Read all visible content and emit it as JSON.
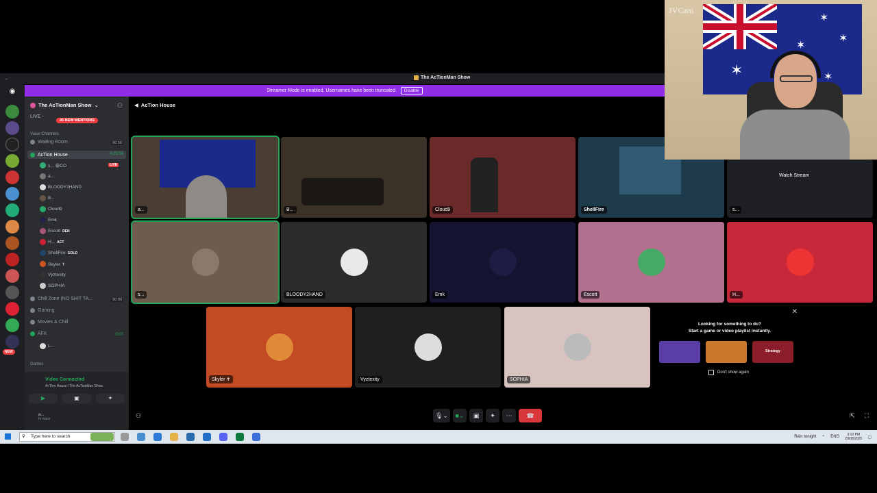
{
  "window": {
    "title": "The AcTionMan Show",
    "streamer_banner": "Streamer Mode is enabled. Usernames have been truncated.",
    "disable_label": "Disable"
  },
  "sidebar": {
    "server_name": "The AcTionMan Show",
    "live_label": "LIVE -",
    "mentions_badge": "45 NEW MENTIONS",
    "voice_channels_label": "Voice Channels",
    "channels": [
      {
        "name": "Waiting Room",
        "count": "00 50"
      },
      {
        "name": "AcTion House",
        "timer": "4:29:56"
      },
      {
        "name": "Chill Zone (NO SHIT TA...",
        "count": "00 99"
      },
      {
        "name": "Gaming"
      },
      {
        "name": "Movies & Chill"
      },
      {
        "name": "AFK",
        "timer": "0:07"
      },
      {
        "name": "Games"
      }
    ],
    "voice_users": [
      {
        "name": "s... 😀CO",
        "live": "LIVE"
      },
      {
        "name": "a..."
      },
      {
        "name": "BLOODY2HAND"
      },
      {
        "name": "B..."
      },
      {
        "name": "Cloud9"
      },
      {
        "name": "Emk"
      },
      {
        "name": "Escott",
        "tag": "DEN"
      },
      {
        "name": "H...",
        "tag": "ACT"
      },
      {
        "name": "ShellFire",
        "tag": "GOLD"
      },
      {
        "name": "Skyler ✝"
      },
      {
        "name": "Vyztexity"
      },
      {
        "name": "SOPHIA"
      }
    ],
    "afk_user": "L...",
    "new_pill": "NEW",
    "voice_status": "Video Connected",
    "voice_sub": "AcTion House / The AcTionMan Show",
    "user_name": "a...",
    "user_status": "In voice"
  },
  "main": {
    "channel_title": "AcTion House",
    "tiles": [
      {
        "name": "a...",
        "bg": "#4a3d33"
      },
      {
        "name": "B...",
        "bg": "#3a3226"
      },
      {
        "name": "Cloud9",
        "bg": "#6b2a2a"
      },
      {
        "name": "ShellFire",
        "bg": "#1d3b4a"
      },
      {
        "name": "s...",
        "bg": "#1e1f22",
        "overlay": "Watch Stream"
      },
      {
        "name": "s...",
        "bg": "#6e5c4e"
      },
      {
        "name": "BLOODY2HAND",
        "bg": "#2b2b2e"
      },
      {
        "name": "Emk",
        "bg": "#141431"
      },
      {
        "name": "Escott",
        "bg": "#b26f8e"
      },
      {
        "name": "H...",
        "bg": "#c8293a"
      },
      {
        "name": "Skyler ✝",
        "bg": "#c24b24"
      },
      {
        "name": "Vyztexity",
        "bg": "#1f1f1f"
      },
      {
        "name": "SOPHIA",
        "bg": "#d8c3c1"
      }
    ],
    "promo": {
      "line1": "Looking for something to do?",
      "line2": "Start a game or video playlist instantly.",
      "cards": [
        "",
        "",
        "Strategy"
      ],
      "dont_show": "Don't show again"
    }
  },
  "webcam": {
    "label": "JVCam"
  },
  "taskbar": {
    "search_placeholder": "Type here to search",
    "weather": "Rain tonight",
    "lang": "ENG",
    "time": "3:10 PM",
    "date": "20/08/2025"
  }
}
